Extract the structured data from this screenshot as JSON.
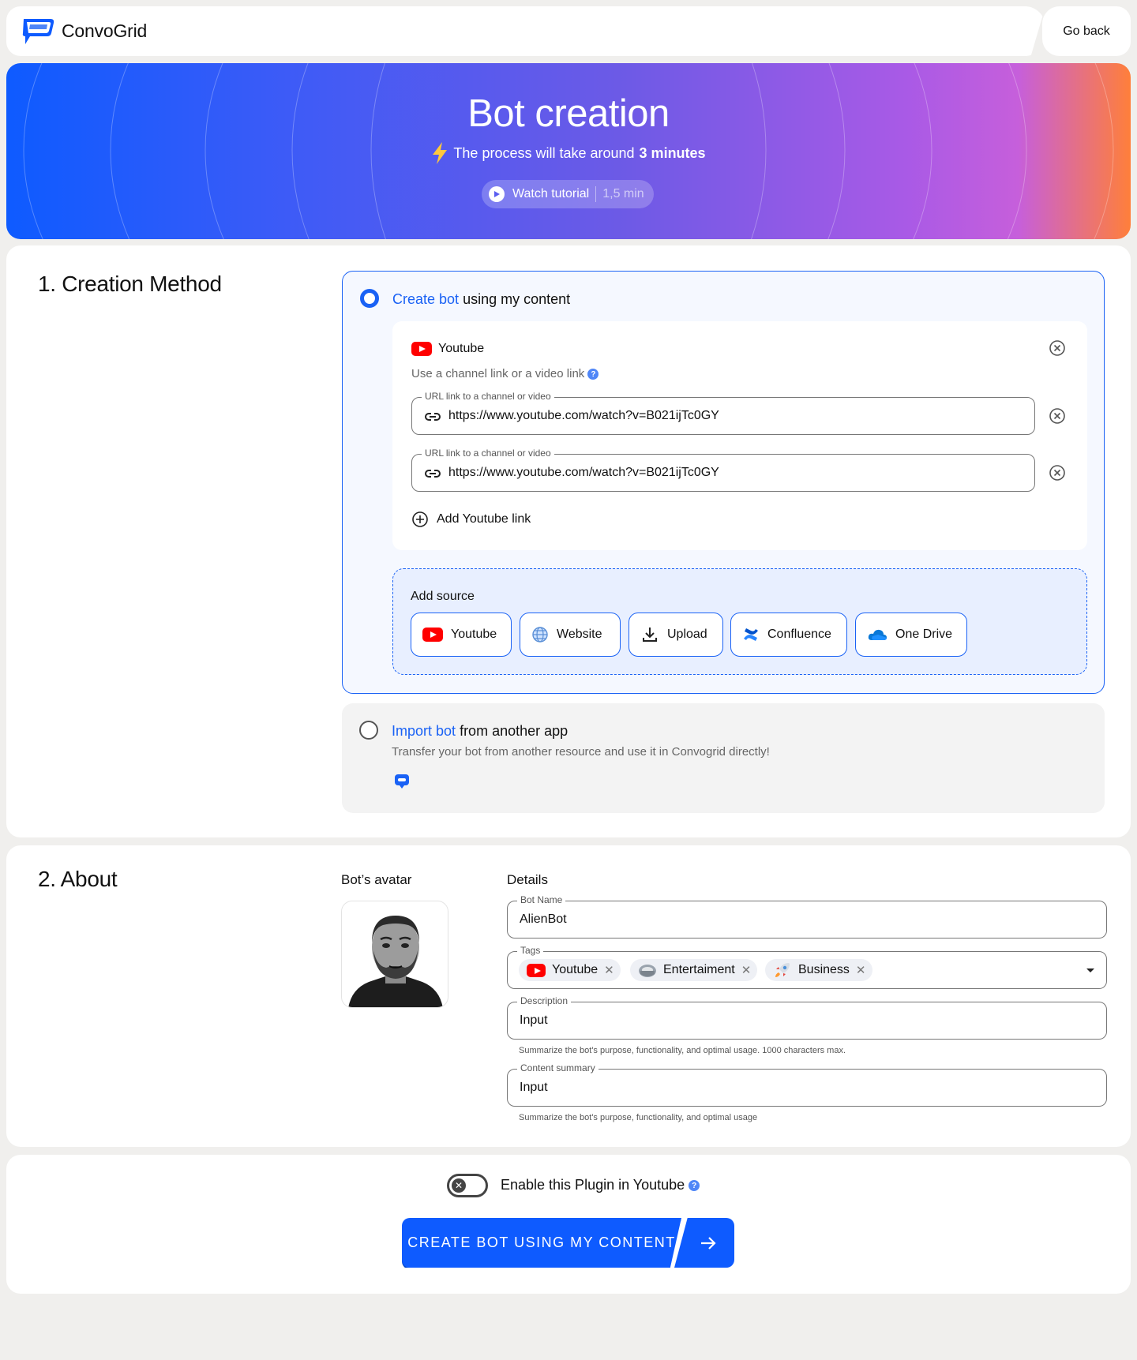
{
  "header": {
    "brand": "ConvoGrid",
    "go_back": "Go back"
  },
  "hero": {
    "title": "Bot creation",
    "subtitle_prefix": "The process will take around",
    "subtitle_bold": "3 minutes",
    "tutorial_label": "Watch tutorial",
    "tutorial_duration": "1,5 min"
  },
  "creation": {
    "section_title": "1. Creation Method",
    "option1": {
      "title_highlight": "Create bot",
      "title_rest": "using my content",
      "source_name": "Youtube",
      "source_hint": "Use a channel link or a video link",
      "links": [
        {
          "label": "URL link to a channel or video",
          "value": "https://www.youtube.com/watch?v=B021ijTc0GY"
        },
        {
          "label": "URL link to a channel or video",
          "value": "https://www.youtube.com/watch?v=B021ijTc0GY"
        }
      ],
      "add_link": "Add Youtube link",
      "add_source_title": "Add source",
      "sources": [
        "Youtube",
        "Website",
        "Upload",
        "Confluence",
        "One Drive"
      ]
    },
    "option2": {
      "title_highlight": "Import bot",
      "title_rest": "from another app",
      "description": "Transfer your bot from another resource and use it in Convogrid directly!"
    }
  },
  "about": {
    "section_title": "2. About",
    "avatar_label": "Bot’s avatar",
    "details_label": "Details",
    "bot_name": {
      "label": "Bot Name",
      "value": "AlienBot"
    },
    "tags": {
      "label": "Tags",
      "items": [
        "Youtube",
        "Entertaiment",
        "Business"
      ]
    },
    "description": {
      "label": "Description",
      "value": "Input",
      "hint": "Summarize the bot's purpose, functionality, and optimal usage. 1000 characters max."
    },
    "content_summary": {
      "label": "Content summary",
      "value": "Input",
      "hint": "Summarize the bot's purpose, functionality, and optimal usage"
    }
  },
  "footer": {
    "toggle_label": "Enable this Plugin in Youtube",
    "toggle_on": false,
    "cta_label": "CREATE BOT USING MY CONTENT"
  },
  "colors": {
    "accent": "#1a62f5",
    "youtube_red": "#ff0000"
  }
}
